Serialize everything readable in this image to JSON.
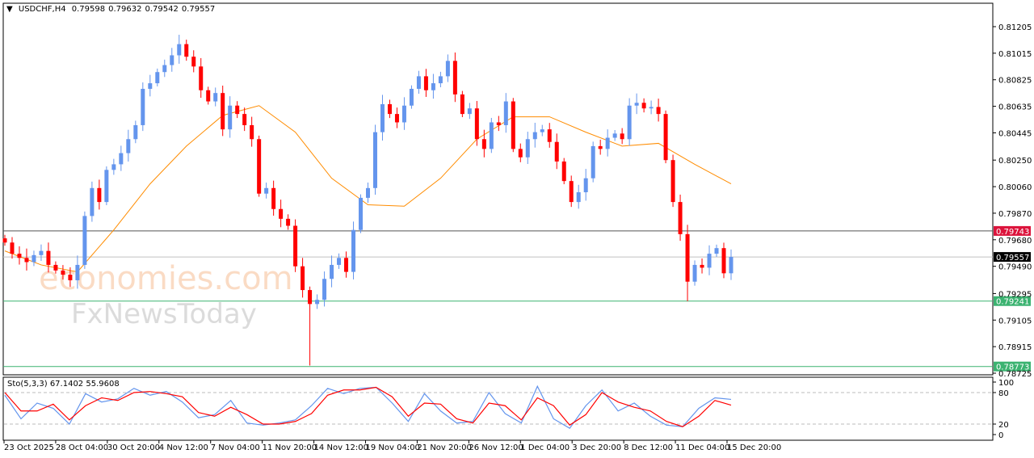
{
  "header": {
    "symbol": "USDCHF,H4",
    "open": "0.79598",
    "high": "0.79632",
    "low": "0.79542",
    "close": "0.79557"
  },
  "watermark": {
    "line1": "economies.com",
    "line2": "FxNewsToday"
  },
  "colors": {
    "bull": "#6495ed",
    "bear": "#ff0000",
    "ma": "#ff8c00",
    "stoch_main": "#6495ed",
    "stoch_signal": "#ff0000",
    "level_red": "#dc143c",
    "level_green": "#3cb371",
    "current": "#000000"
  },
  "chart_data": [
    {
      "type": "candlestick",
      "title": "USDCHF,H4",
      "y_ticks": [
        "0.81205",
        "0.81015",
        "0.80825",
        "0.80635",
        "0.80445",
        "0.80250",
        "0.80060",
        "0.79870",
        "0.79680",
        "0.79490",
        "0.79295",
        "0.79105",
        "0.78915",
        "0.78725"
      ],
      "ylim": [
        0.78725,
        0.81205
      ],
      "x_ticks": [
        "23 Oct 2025",
        "28 Oct 04:00",
        "30 Oct 20:00",
        "4 Nov 12:00",
        "7 Nov 04:00",
        "11 Nov 20:00",
        "14 Nov 12:00",
        "19 Nov 04:00",
        "21 Nov 20:00",
        "26 Nov 12:00",
        "1 Dec 04:00",
        "3 Dec 20:00",
        "8 Dec 12:00",
        "11 Dec 04:00",
        "15 Dec 20:00"
      ],
      "closes": [
        0.7966,
        0.7958,
        0.7955,
        0.7952,
        0.7957,
        0.796,
        0.795,
        0.7946,
        0.7943,
        0.7939,
        0.795,
        0.7985,
        0.8005,
        0.7995,
        0.8018,
        0.8022,
        0.803,
        0.804,
        0.805,
        0.8076,
        0.808,
        0.8088,
        0.8093,
        0.81,
        0.8108,
        0.8099,
        0.8092,
        0.8075,
        0.8067,
        0.8073,
        0.8047,
        0.8064,
        0.8058,
        0.805,
        0.804,
        0.8001,
        0.8005,
        0.799,
        0.7983,
        0.7978,
        0.7949,
        0.7932,
        0.7922,
        0.7925,
        0.794,
        0.795,
        0.7955,
        0.7945,
        0.7975,
        0.7998,
        0.8005,
        0.8045,
        0.8065,
        0.8058,
        0.8052,
        0.8064,
        0.8076,
        0.8085,
        0.8075,
        0.808,
        0.8085,
        0.8096,
        0.8072,
        0.8058,
        0.8062,
        0.804,
        0.8033,
        0.8052,
        0.805,
        0.8067,
        0.8033,
        0.8027,
        0.804,
        0.8045,
        0.8047,
        0.8038,
        0.8024,
        0.801,
        0.7995,
        0.8002,
        0.8012,
        0.8035,
        0.8033,
        0.8041,
        0.8044,
        0.804,
        0.8064,
        0.8066,
        0.8062,
        0.8063,
        0.8058,
        0.8025,
        0.7995,
        0.7972,
        0.7938,
        0.795,
        0.7948,
        0.7958,
        0.7962,
        0.7944,
        0.79557
      ],
      "notable_lows": [
        {
          "index": 42,
          "low": 0.7878
        },
        {
          "index": 94,
          "low": 0.7924
        }
      ],
      "moving_average": [
        0.796,
        0.795,
        0.7945,
        0.7975,
        0.8008,
        0.8035,
        0.8057,
        0.8064,
        0.8045,
        0.8012,
        0.7993,
        0.7992,
        0.8012,
        0.804,
        0.8056,
        0.8056,
        0.8045,
        0.8035,
        0.8037,
        0.8022,
        0.8008
      ],
      "levels": [
        {
          "value": "0.79743",
          "style": "red"
        },
        {
          "value": "0.79557",
          "style": "current"
        },
        {
          "value": "0.79241",
          "style": "green"
        },
        {
          "value": "0.78773",
          "style": "green"
        }
      ]
    },
    {
      "type": "line",
      "title": "Sto(5,3,3) 67.1402 55.9608",
      "y_ticks": [
        "100",
        "80",
        "20",
        "0"
      ],
      "ylim": [
        0,
        100
      ],
      "levels": [
        80,
        20
      ],
      "series": [
        {
          "values": [
            75,
            30,
            60,
            50,
            20,
            78,
            62,
            68,
            88,
            75,
            82,
            62,
            32,
            38,
            65,
            22,
            18,
            22,
            28,
            55,
            88,
            78,
            88,
            90,
            60,
            25,
            78,
            45,
            22,
            25,
            80,
            40,
            22,
            92,
            30,
            12,
            55,
            85,
            45,
            60,
            35,
            18,
            15,
            50,
            70,
            67
          ]
        },
        {
          "values": [
            80,
            45,
            45,
            58,
            28,
            55,
            70,
            65,
            80,
            82,
            78,
            72,
            42,
            35,
            52,
            38,
            20,
            20,
            25,
            40,
            75,
            85,
            85,
            90,
            72,
            35,
            60,
            58,
            30,
            22,
            60,
            55,
            28,
            70,
            55,
            18,
            38,
            80,
            62,
            52,
            45,
            25,
            15,
            35,
            65,
            56
          ]
        }
      ]
    }
  ]
}
